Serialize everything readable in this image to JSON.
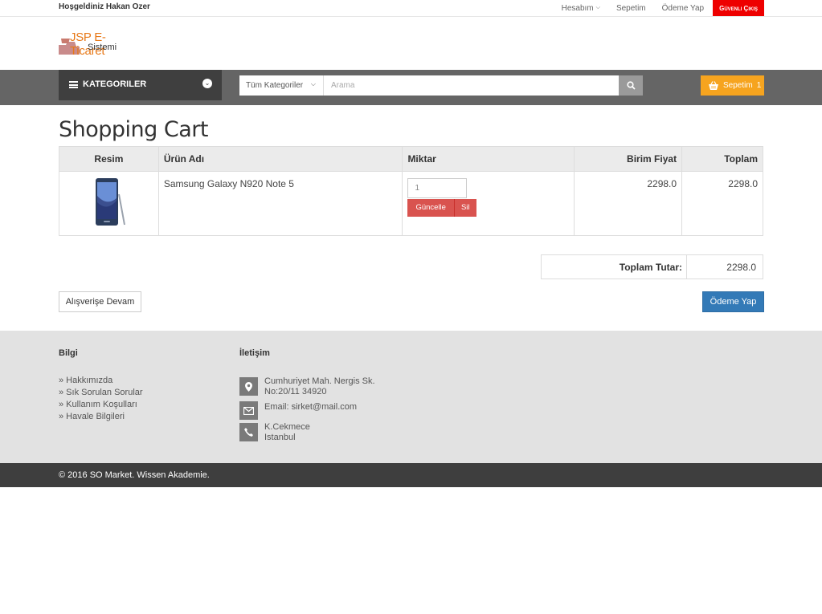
{
  "topbar": {
    "welcome": "Hoşgeldiniz Hakan Ozer",
    "account": "Hesabım",
    "cart": "Sepetim",
    "checkout": "Ödeme Yap",
    "logout": "Güvenli Çıkış"
  },
  "logo": {
    "title": "JSP E-Ticaret",
    "subtitle": "Sistemi"
  },
  "nav": {
    "categories": "KATEGORILER",
    "search_category": "Tüm Kategoriler",
    "search_placeholder": "Arama",
    "cart_label": "Sepetim",
    "cart_count": "1"
  },
  "cart": {
    "title": "Shopping Cart",
    "headers": {
      "image": "Resim",
      "name": "Ürün Adı",
      "qty": "Miktar",
      "unit_price": "Birim Fiyat",
      "total": "Toplam"
    },
    "items": [
      {
        "name": "Samsung Galaxy N920 Note 5",
        "qty": "1",
        "unit_price": "2298.0",
        "total": "2298.0",
        "update_label": "Güncelle",
        "delete_label": "Sil"
      }
    ],
    "sum_label": "Toplam Tutar:",
    "sum_value": "2298.0",
    "continue_label": "Alışverişe Devam",
    "checkout_label": "Ödeme Yap"
  },
  "footer": {
    "info_title": "Bilgi",
    "links": [
      "» Hakkımızda",
      "» Sık Sorulan Sorular",
      "» Kullanım Koşulları",
      "» Havale Bilgileri"
    ],
    "contact_title": "İletişim",
    "address_line1": "Cumhuriyet Mah. Nergis Sk.",
    "address_line2": "No:20/11 34920",
    "email": "Email: sirket@mail.com",
    "phone_line1": "K.Cekmece",
    "phone_line2": "Istanbul",
    "copyright": "© 2016 SO Market. Wissen Akademie."
  },
  "colors": {
    "accent_orange": "#f6a41f",
    "logout_red": "#ee0000",
    "action_red": "#d9534f",
    "primary_blue": "#337ab7"
  }
}
